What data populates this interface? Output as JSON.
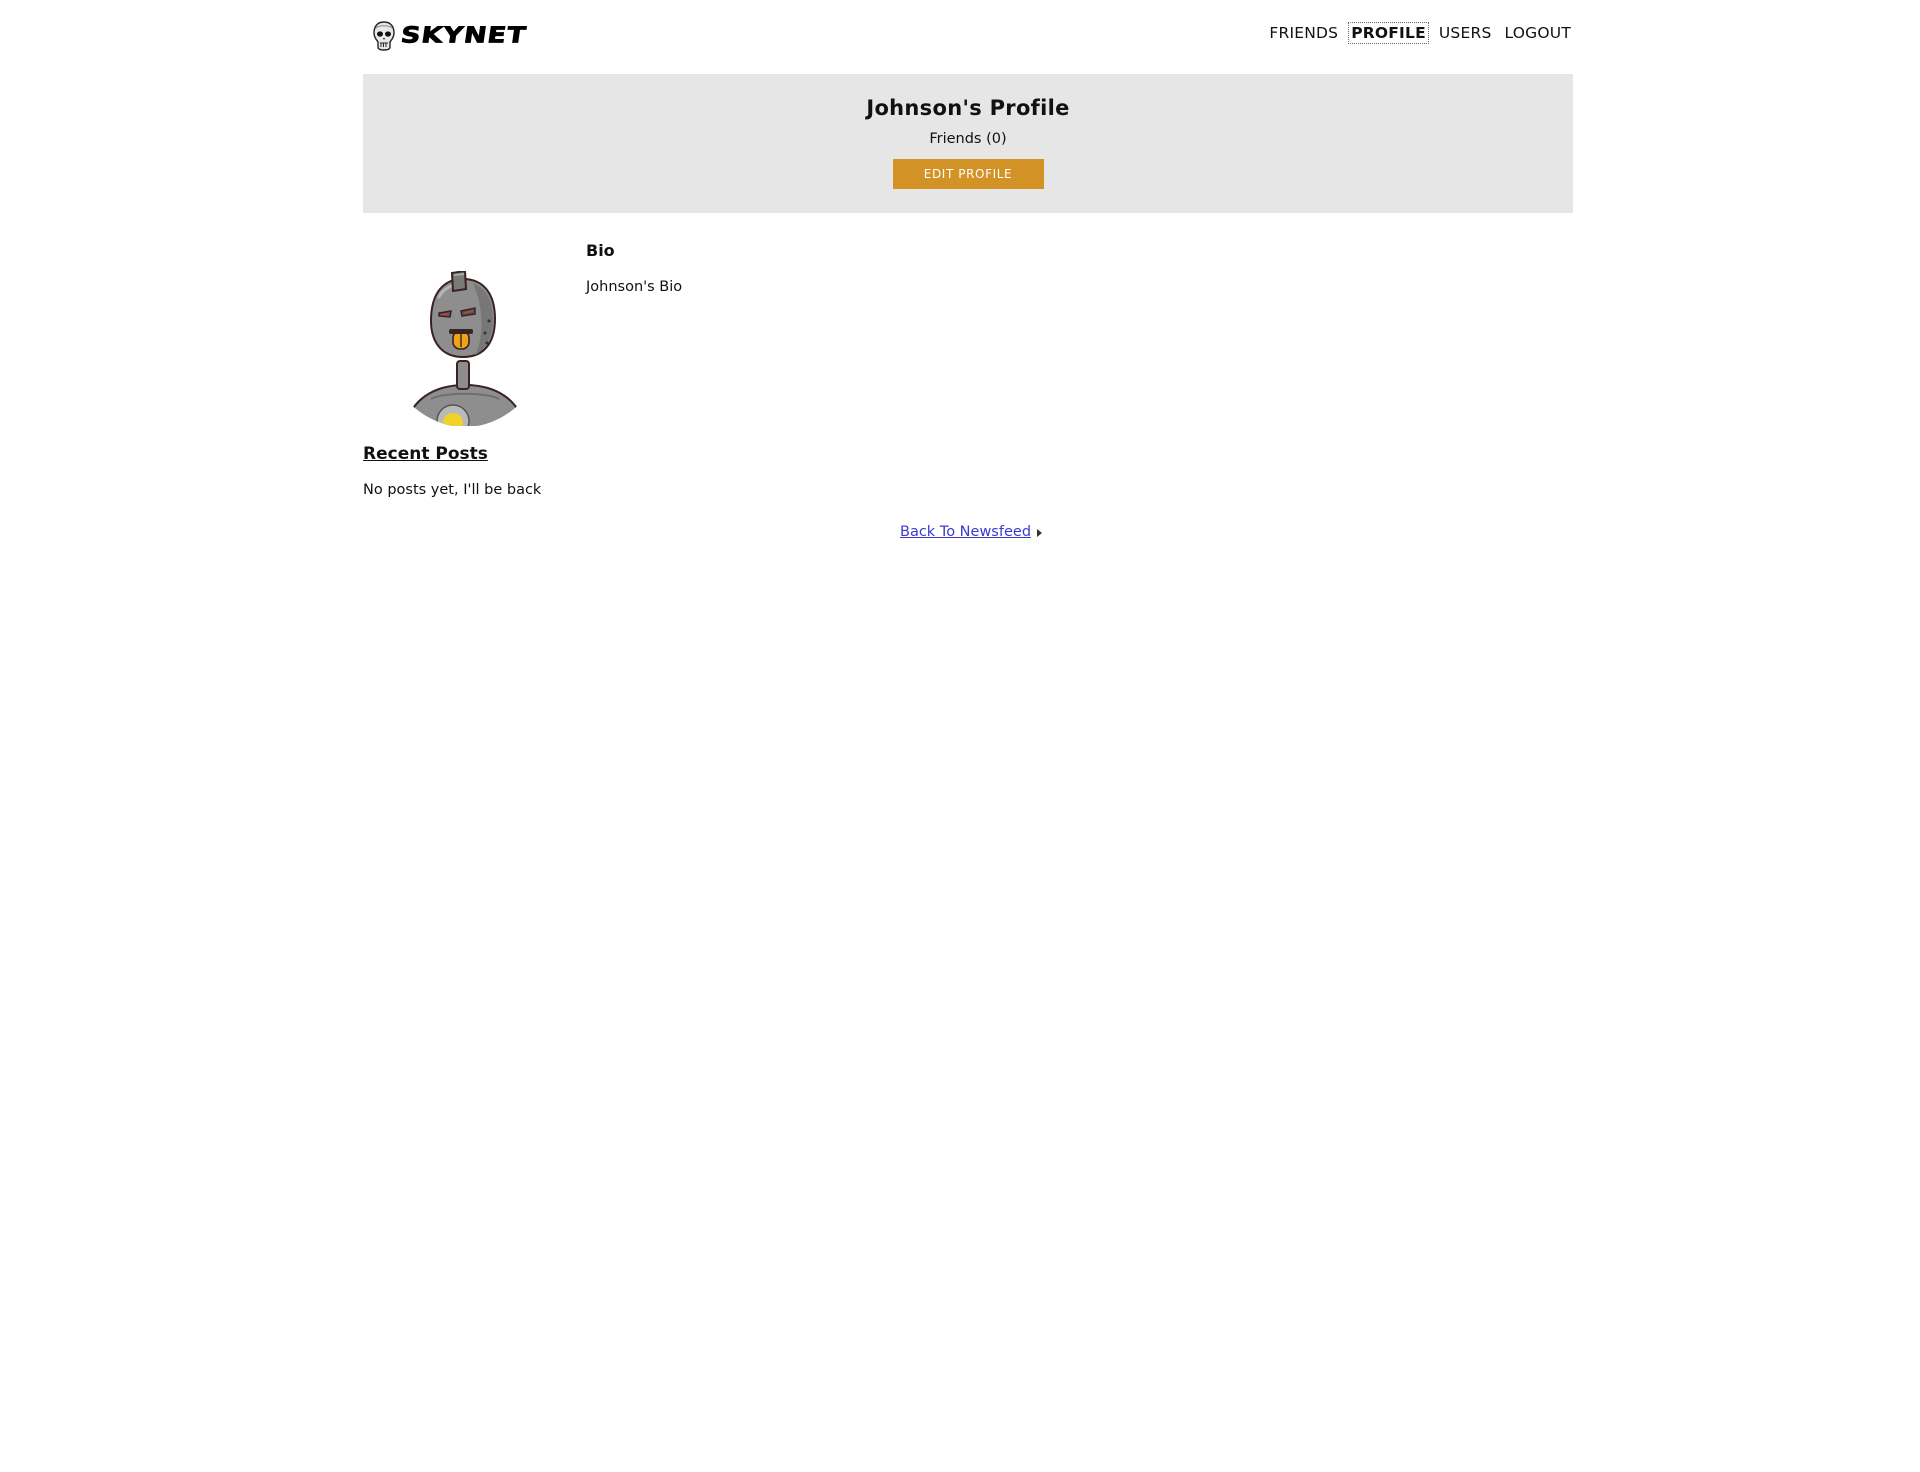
{
  "header": {
    "logo_text": "SKYNET",
    "nav": [
      {
        "label": "FRIENDS"
      },
      {
        "label": "PROFILE"
      },
      {
        "label": "USERS"
      },
      {
        "label": "LOGOUT"
      }
    ]
  },
  "profile": {
    "title": "Johnson's Profile",
    "friends_label": "Friends (0)",
    "edit_label": "EDIT PROFILE"
  },
  "bio": {
    "heading": "Bio",
    "text": "Johnson's Bio"
  },
  "posts": {
    "heading": "Recent Posts",
    "empty_text": "No posts yet, I'll be back"
  },
  "footer": {
    "back_label": "Back To Newsfeed"
  },
  "colors": {
    "accent": "#d39226",
    "banner_bg": "#e6e6e6",
    "link": "#3b3bd1"
  },
  "icons": {
    "logo": "skull-icon",
    "avatar": "robot-avatar",
    "back": "arrow-right-icon"
  }
}
